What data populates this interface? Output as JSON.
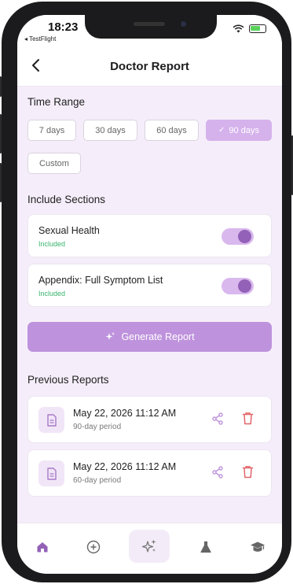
{
  "status_bar": {
    "time": "18:23",
    "back_app": "◂ TestFlight"
  },
  "header": {
    "title": "Doctor Report"
  },
  "time_range": {
    "title": "Time Range",
    "options": [
      {
        "label": "7 days",
        "selected": false
      },
      {
        "label": "30 days",
        "selected": false
      },
      {
        "label": "60 days",
        "selected": false
      },
      {
        "label": "90 days",
        "selected": true
      },
      {
        "label": "Custom",
        "selected": false
      }
    ]
  },
  "include_sections": {
    "title": "Include Sections",
    "items": [
      {
        "label": "Sexual Health",
        "status": "Included",
        "enabled": true
      },
      {
        "label": "Appendix: Full Symptom List",
        "status": "Included",
        "enabled": true
      }
    ]
  },
  "generate": {
    "label": "Generate Report"
  },
  "previous_reports": {
    "title": "Previous Reports",
    "items": [
      {
        "title": "May 22, 2026 11:12 AM",
        "period": "90-day period"
      },
      {
        "title": "May 22, 2026 11:12 AM",
        "period": "60-day period"
      }
    ]
  },
  "tab_bar": {
    "items": [
      {
        "icon": "home-icon",
        "active": true
      },
      {
        "icon": "plus-circle-icon",
        "active": false
      },
      {
        "icon": "sparkles-icon",
        "active": false
      },
      {
        "icon": "flask-icon",
        "active": false
      },
      {
        "icon": "graduation-cap-icon",
        "active": false
      }
    ]
  },
  "colors": {
    "accent": "#be92dc",
    "accent_dark": "#9361b7",
    "included_green": "#3ab56e",
    "delete_red": "#e2646a",
    "background": "#f5eefa"
  }
}
